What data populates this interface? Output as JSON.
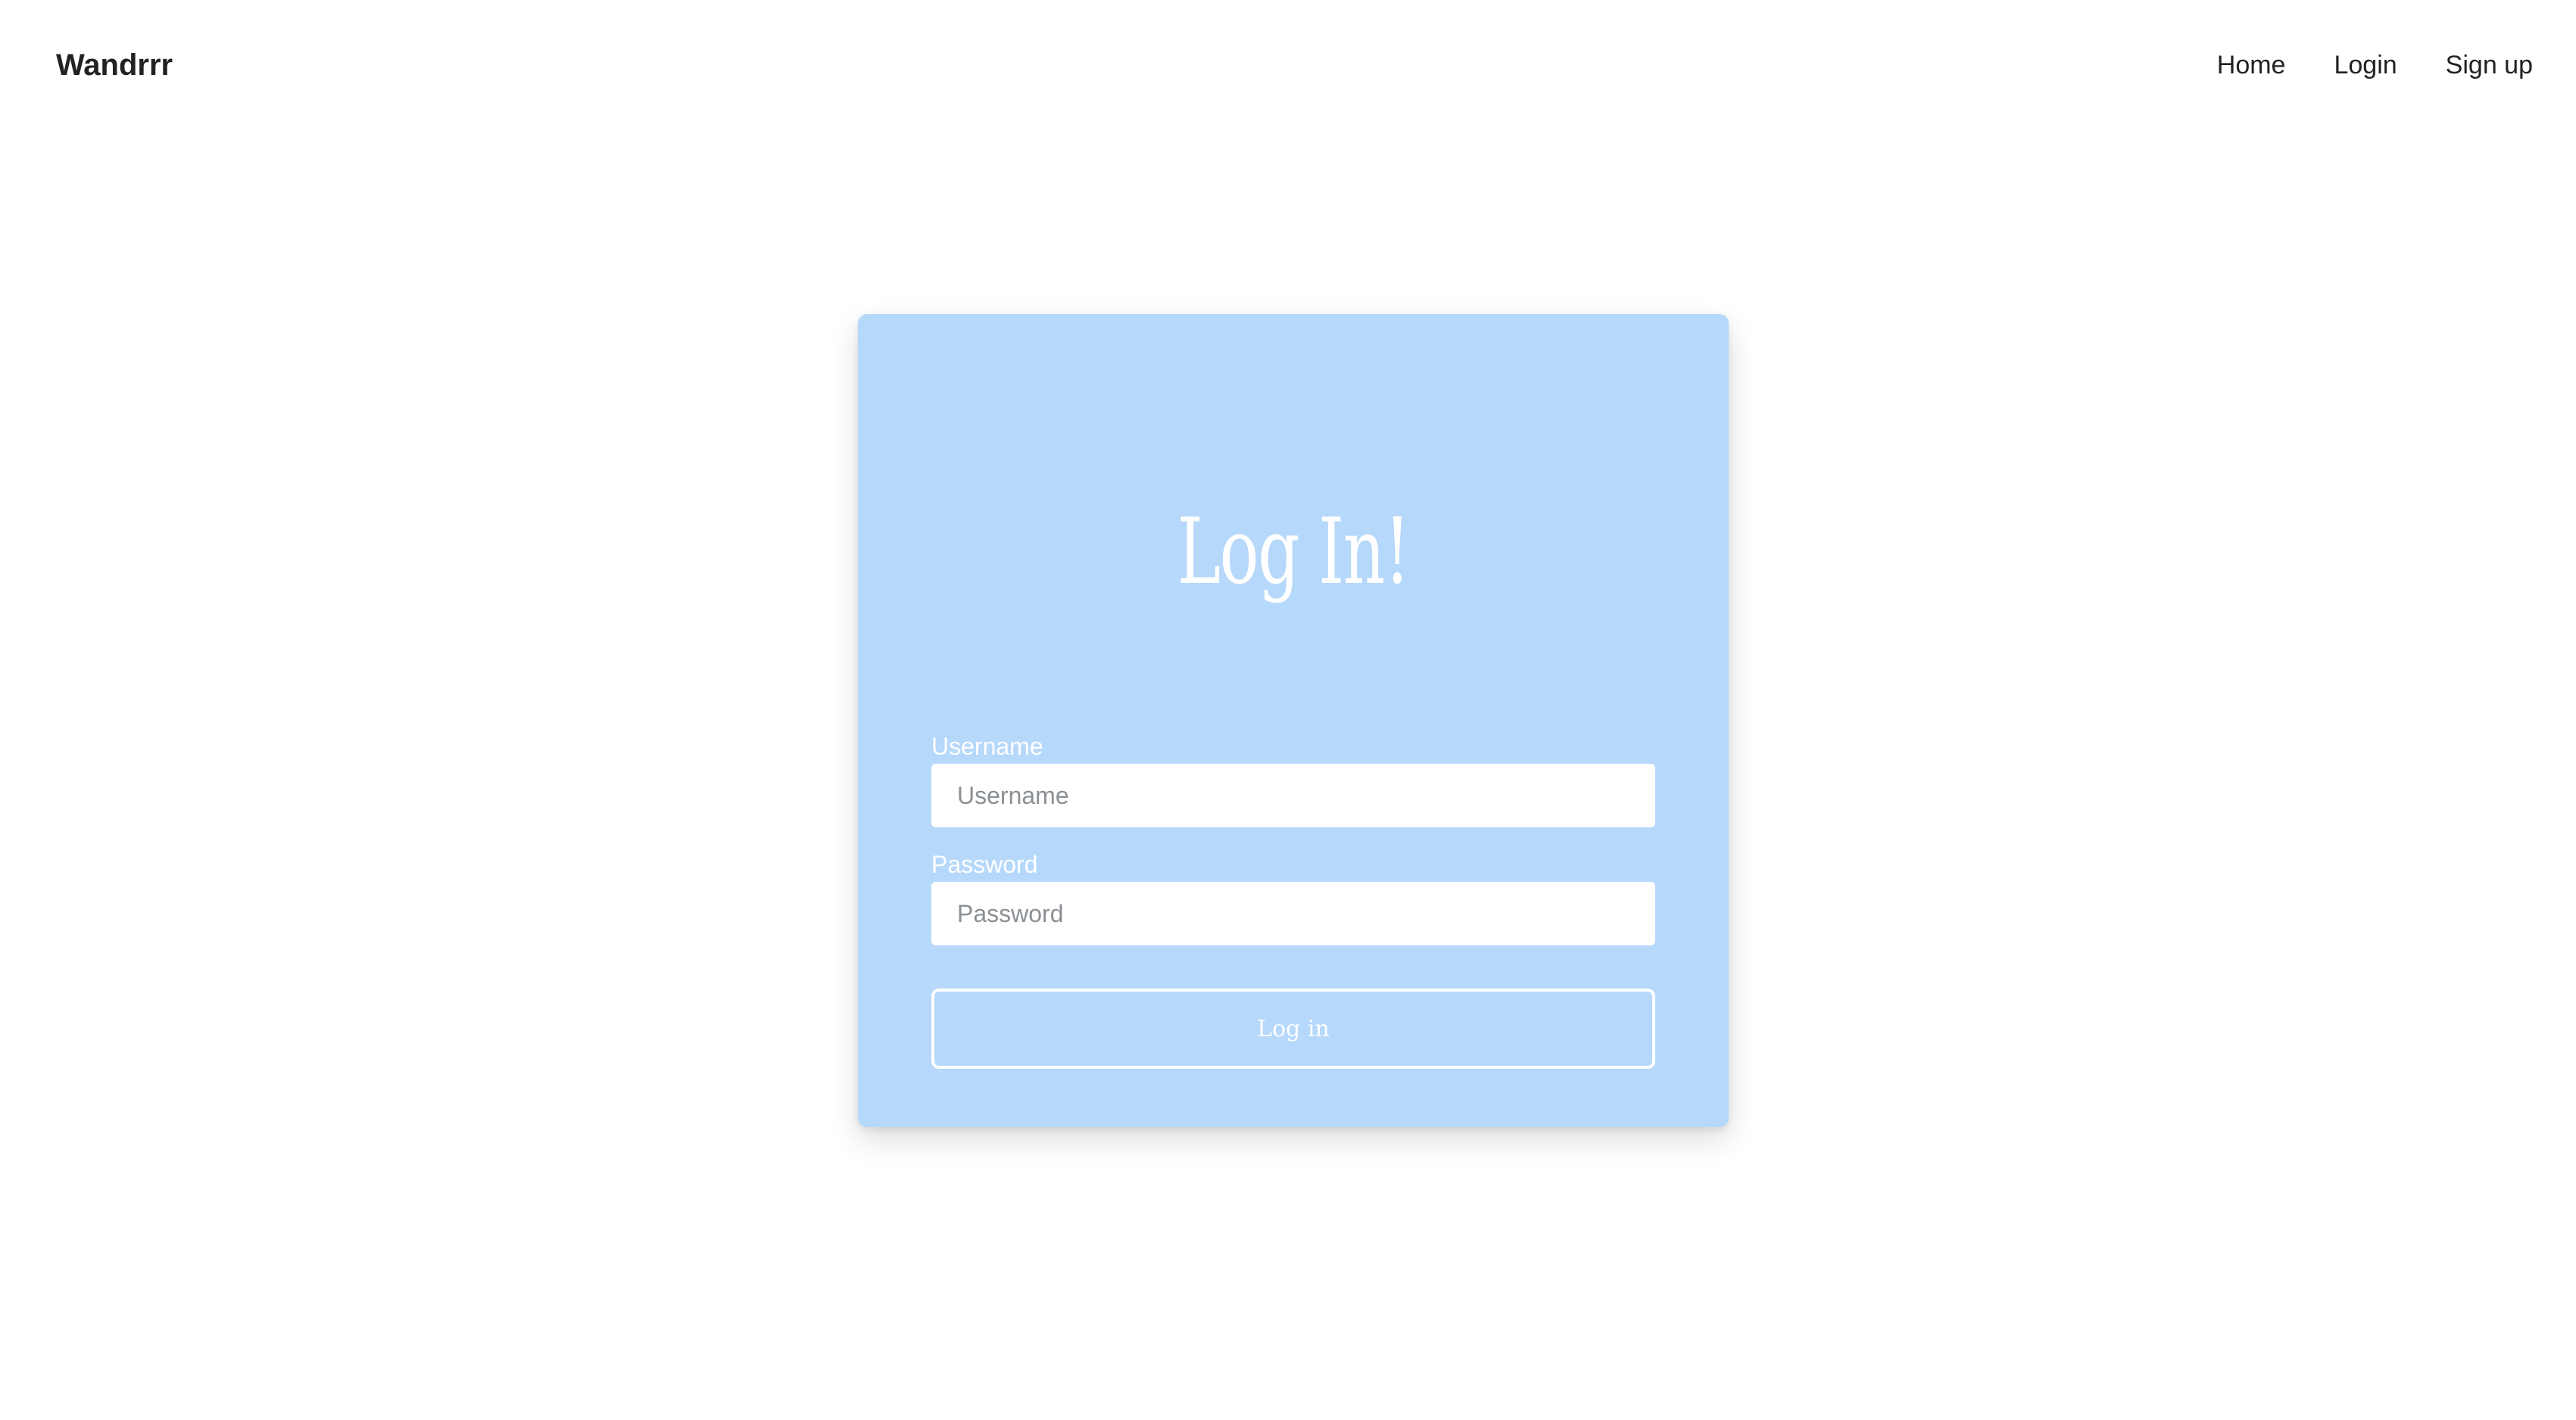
{
  "navbar": {
    "brand": "Wandrrr",
    "links": [
      {
        "label": "Home"
      },
      {
        "label": "Login"
      },
      {
        "label": "Sign up"
      }
    ]
  },
  "login_card": {
    "title": "Log In!",
    "background_color": "#b6d8fa",
    "username": {
      "label": "Username",
      "placeholder": "Username",
      "value": ""
    },
    "password": {
      "label": "Password",
      "placeholder": "Password",
      "value": ""
    },
    "submit_label": "Log in"
  }
}
